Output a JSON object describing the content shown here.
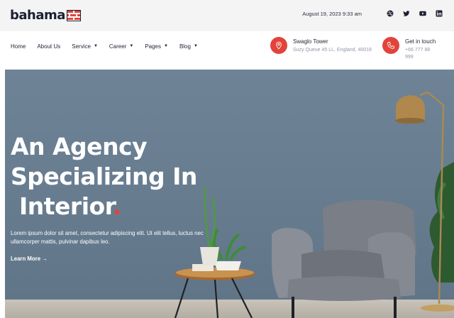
{
  "brand": {
    "name": "bahama",
    "logo_icon": "brick-logo-icon"
  },
  "topbar": {
    "date": "August 19, 2023 9:33 am",
    "social": [
      {
        "name": "dribbble-icon"
      },
      {
        "name": "twitter-icon"
      },
      {
        "name": "youtube-icon"
      },
      {
        "name": "linkedin-icon"
      }
    ]
  },
  "nav": {
    "items": [
      {
        "label": "Home",
        "has_dropdown": false
      },
      {
        "label": "About Us",
        "has_dropdown": false
      },
      {
        "label": "Service",
        "has_dropdown": true
      },
      {
        "label": "Career",
        "has_dropdown": true
      },
      {
        "label": "Pages",
        "has_dropdown": true
      },
      {
        "label": "Blog",
        "has_dropdown": true
      }
    ]
  },
  "contact": {
    "location": {
      "title": "Swaglo Tower",
      "sub": "Suzy Queue 45 LL, England, 40018",
      "icon": "map-pin-icon"
    },
    "phone": {
      "title": "Get in touch",
      "sub": "+66 777 88 999",
      "icon": "phone-icon"
    }
  },
  "hero": {
    "line1": "An Agency",
    "line2": "Specializing In",
    "line3": "Interior",
    "dot": ".",
    "description": "Lorem ipsum dolor sit amet, consectetur adipiscing elit. Ut elit tellus, luctus nec ullamcorper mattis, pulvinar dapibus leo.",
    "cta": "Learn More",
    "cta_arrow": "→"
  },
  "colors": {
    "accent": "#e2433a",
    "dark": "#1b2030",
    "topbar_bg": "#f4f4f5",
    "wall": "#6e8395"
  }
}
